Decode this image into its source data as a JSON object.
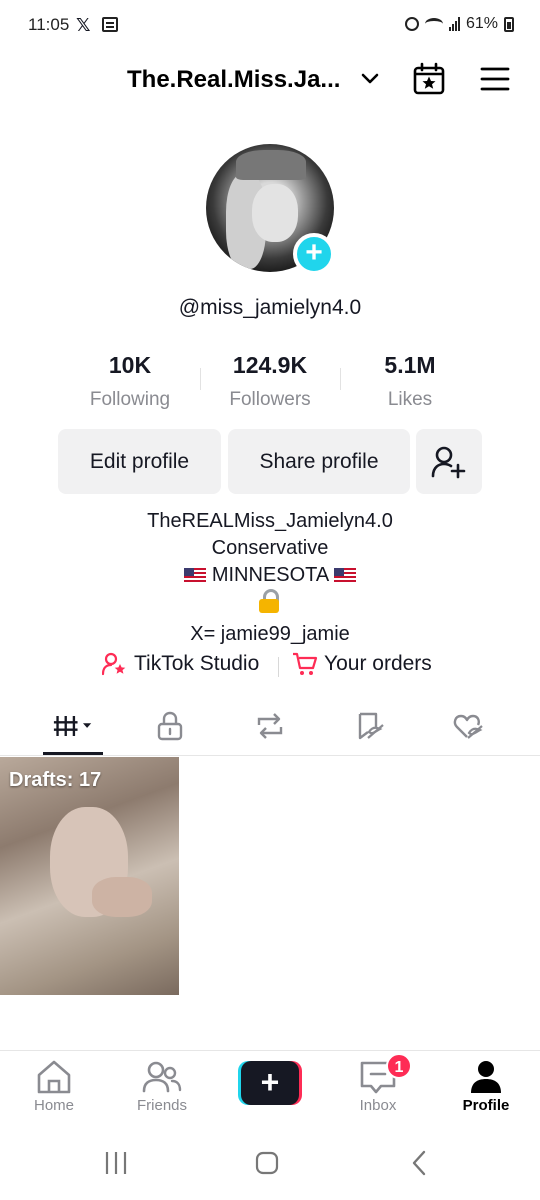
{
  "status_bar": {
    "time": "11:05",
    "x_glyph": "𝕏",
    "battery": "61%"
  },
  "header": {
    "username": "The.Real.Miss.Ja...",
    "icons": [
      "chevron-down-icon",
      "calendar-star-icon",
      "menu-icon"
    ]
  },
  "profile": {
    "handle": "@miss_jamielyn4.0"
  },
  "stats": [
    {
      "value": "10K",
      "label": "Following"
    },
    {
      "value": "124.9K",
      "label": "Followers"
    },
    {
      "value": "5.1M",
      "label": "Likes"
    }
  ],
  "actions": {
    "edit": "Edit profile",
    "share": "Share profile"
  },
  "bio": {
    "line1": "TheREALMiss_Jamielyn4.0",
    "line2": "Conservative",
    "line3": "MINNESOTA",
    "line5": "X= jamie99_jamie"
  },
  "links": {
    "studio": "TikTok Studio",
    "orders": "Your orders"
  },
  "tabs": [
    "videos-grid-icon",
    "lock-icon",
    "repost-icon",
    "favorites-icon",
    "liked-icon"
  ],
  "grid": {
    "drafts_label": "Drafts: 17"
  },
  "bottom_nav": {
    "home": "Home",
    "friends": "Friends",
    "create": "+",
    "inbox": "Inbox",
    "inbox_badge": "1",
    "profile": "Profile"
  },
  "colors": {
    "accent_cyan": "#20d5ec",
    "accent_red": "#fe2c55",
    "text": "#161823",
    "muted": "#8a8b91"
  }
}
